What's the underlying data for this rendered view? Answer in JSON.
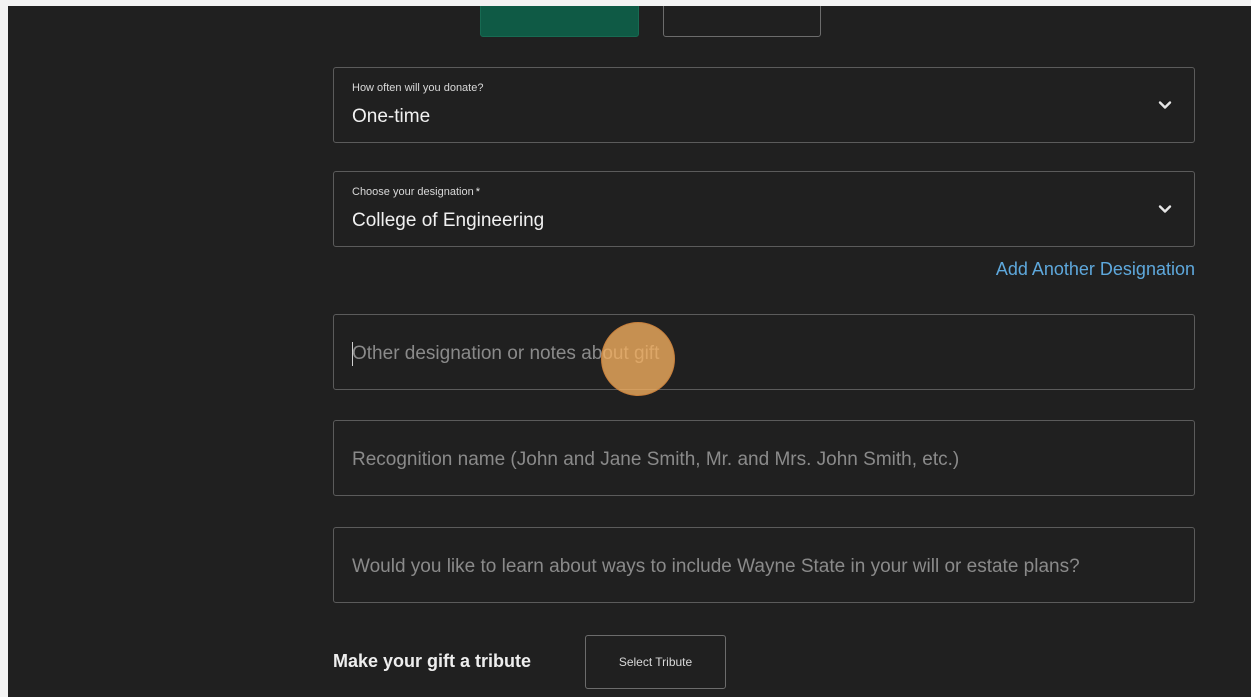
{
  "frequency": {
    "label": "How often will you donate?",
    "value": "One-time"
  },
  "designation": {
    "label": "Choose your designation",
    "required_mark": "*",
    "value": "College of Engineering",
    "add_another_label": "Add Another Designation"
  },
  "notes": {
    "placeholder": "Other designation or notes about gift"
  },
  "recognition": {
    "placeholder": "Recognition name (John and Jane Smith, Mr. and Mrs. John Smith, etc.)"
  },
  "estate": {
    "placeholder": "Would you like to learn about ways to include Wayne State in your will or estate plans?"
  },
  "tribute": {
    "label": "Make your gift a tribute",
    "button_label": "Select Tribute"
  },
  "colors": {
    "background": "#202020",
    "active_toggle": "#0f5a45",
    "link": "#5ea8dc",
    "click_marker": "#f5af5f"
  }
}
